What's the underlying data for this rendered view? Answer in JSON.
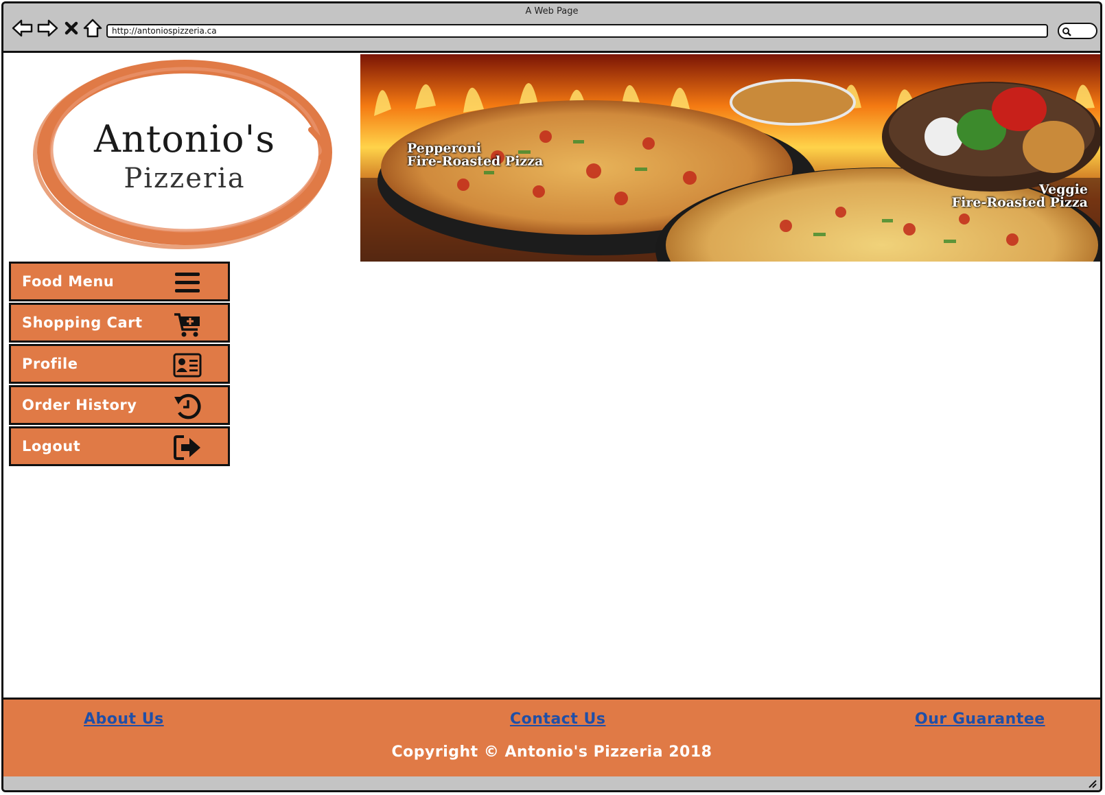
{
  "window": {
    "title": "A Web Page"
  },
  "browser": {
    "url": "http://antoniospizzeria.ca"
  },
  "logo": {
    "brand": "Antonio's",
    "sub": "Pizzeria"
  },
  "banner": {
    "pizza_left": {
      "line1": "Pepperoni",
      "line2": "Fire-Roasted Pizza"
    },
    "pizza_right": {
      "line1": "Veggie",
      "line2": "Fire-Roasted Pizza"
    }
  },
  "sidebar": {
    "items": [
      {
        "label": "Food Menu",
        "icon": "menu-icon"
      },
      {
        "label": "Shopping Cart",
        "icon": "cart-add-icon"
      },
      {
        "label": "Profile",
        "icon": "id-card-icon"
      },
      {
        "label": "Order History",
        "icon": "history-icon"
      },
      {
        "label": "Logout",
        "icon": "logout-icon"
      }
    ]
  },
  "footer": {
    "links": [
      "About Us",
      "Contact Us",
      "Our Guarantee"
    ],
    "copyright": "Copyright © Antonio's Pizzeria 2018"
  },
  "colors": {
    "accent": "#e07a46",
    "link": "#1f4fa8",
    "chrome": "#c4c4c4"
  }
}
